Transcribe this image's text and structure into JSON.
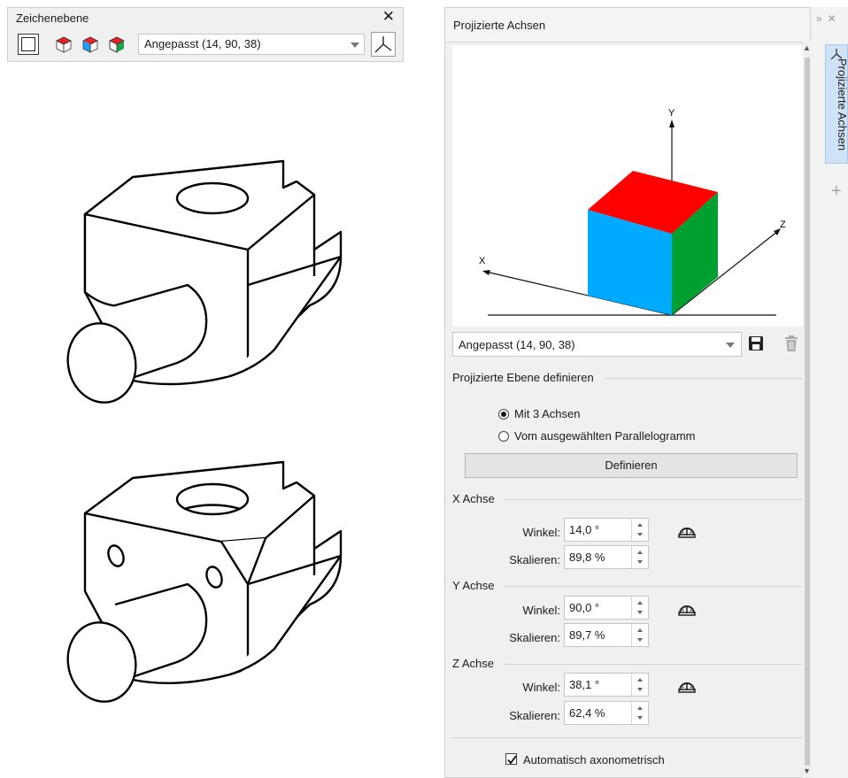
{
  "toolbar": {
    "title": "Zeichenebene",
    "close_label": "✕",
    "preset_value": "Angepasst (14, 90, 38)",
    "icons": [
      "frame-icon",
      "cube-red-top-icon",
      "cube-left-icon",
      "cube-right-icon",
      "projected-axes-icon"
    ]
  },
  "panel": {
    "title": "Projizierte Achsen",
    "preview": {
      "axis_y": "Y",
      "axis_x": "X",
      "axis_z": "Z",
      "colors": {
        "top": "#ff0000",
        "front": "#00aaff",
        "side": "#00a030"
      }
    },
    "preset_value": "Angepasst (14, 90, 38)",
    "define_section": "Projizierte Ebene definieren",
    "radio_3axes": "Mit 3 Achsen",
    "radio_parallelogram": "Vom ausgewählten Parallelogramm",
    "radio_selected": "Mit 3 Achsen",
    "define_button": "Definieren",
    "x_axis": {
      "label": "X Achse",
      "angle_label": "Winkel:",
      "angle": "14,0 °",
      "scale_label": "Skalieren:",
      "scale": "89,8 %"
    },
    "y_axis": {
      "label": "Y Achse",
      "angle_label": "Winkel:",
      "angle": "90,0 °",
      "scale_label": "Skalieren:",
      "scale": "89,7 %"
    },
    "z_axis": {
      "label": "Z Achse",
      "angle_label": "Winkel:",
      "angle": "38,1 °",
      "scale_label": "Skalieren:",
      "scale": "62,4 %"
    },
    "auto_checkbox": "Automatisch axonometrisch",
    "auto_checked": true
  },
  "tabs": {
    "active_tab": "Projizierte Achsen",
    "add_label": "+"
  }
}
